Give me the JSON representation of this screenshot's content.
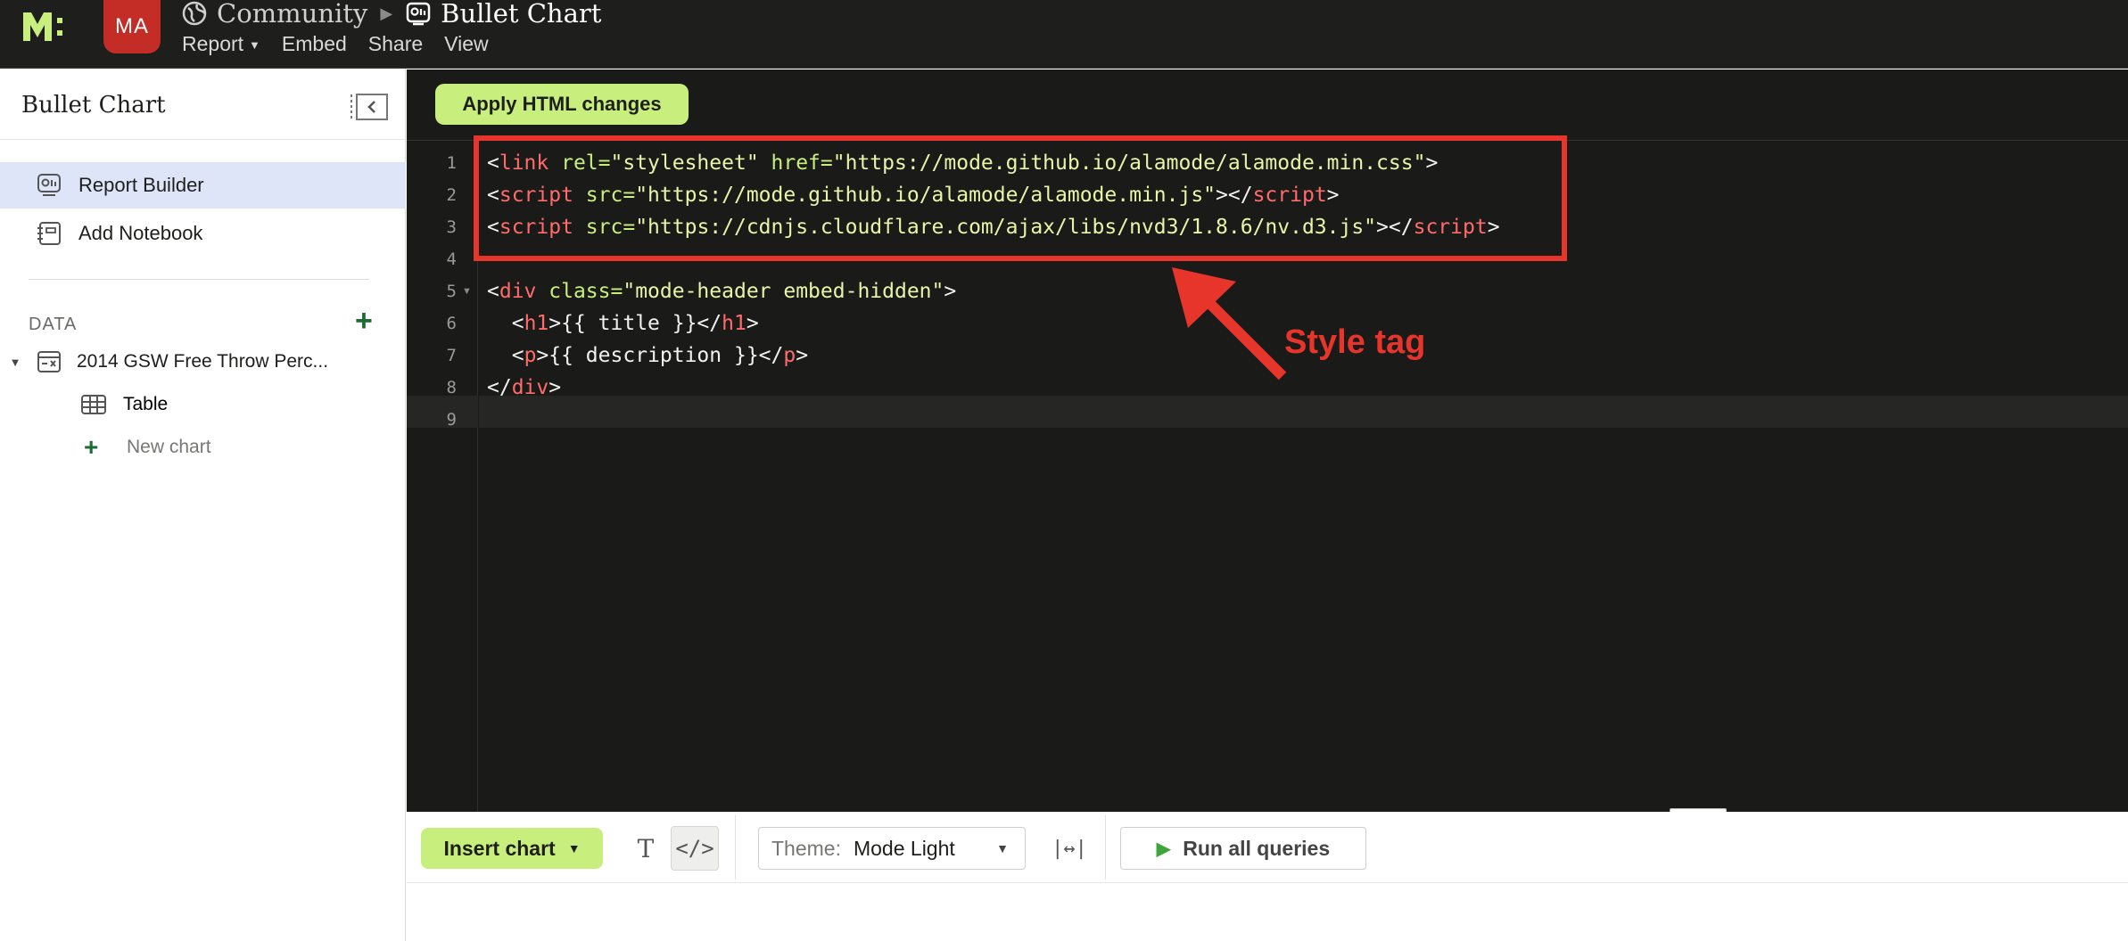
{
  "topbar": {
    "avatar_initials": "MA",
    "breadcrumb": {
      "workspace": "Community",
      "report": "Bullet Chart"
    },
    "menu": {
      "report": "Report",
      "embed": "Embed",
      "share": "Share",
      "view": "View"
    }
  },
  "sidebar": {
    "title": "Bullet Chart",
    "items": [
      {
        "label": "Report Builder",
        "icon": "report-builder-icon",
        "active": true
      },
      {
        "label": "Add Notebook",
        "icon": "notebook-icon",
        "active": false
      }
    ],
    "data_section": {
      "heading": "DATA",
      "dataset": "2014 GSW Free Throw Perc...",
      "children": [
        {
          "label": "Table",
          "icon": "table-icon"
        },
        {
          "label": "New chart",
          "icon": "plus-icon"
        }
      ]
    }
  },
  "editor": {
    "apply_label": "Apply HTML changes",
    "line_numbers": [
      "1",
      "2",
      "3",
      "4",
      "5",
      "6",
      "7",
      "8",
      "9"
    ],
    "code": {
      "l1": {
        "open": "<",
        "tag": "link",
        "attr1": " rel=",
        "val1": "\"stylesheet\"",
        "attr2": " href=",
        "val2": "\"https://mode.github.io/alamode/alamode.min.css\"",
        "close": ">"
      },
      "l2": {
        "open": "<",
        "tag": "script",
        "attr1": " src=",
        "val1": "\"https://mode.github.io/alamode/alamode.min.js\"",
        "mid": "></",
        "tag2": "script",
        "close": ">"
      },
      "l3": {
        "open": "<",
        "tag": "script",
        "attr1": " src=",
        "val1": "\"https://cdnjs.cloudflare.com/ajax/libs/nvd3/1.8.6/nv.d3.js\"",
        "mid": "></",
        "tag2": "script",
        "close": ">"
      },
      "l5": {
        "open": "<",
        "tag": "div",
        "attr1": " class=",
        "val1": "\"mode-header embed-hidden\"",
        "close": ">"
      },
      "l6": {
        "indent": "  ",
        "open": "<",
        "tag": "h1",
        "text": ">{{ title }}</",
        "tag2": "h1",
        "close": ">"
      },
      "l7": {
        "indent": "  ",
        "open": "<",
        "tag": "p",
        "text": ">{{ description }}</",
        "tag2": "p",
        "close": ">"
      },
      "l8": {
        "open": "</",
        "tag": "div",
        "close": ">"
      }
    }
  },
  "annotation": {
    "label": "Style tag",
    "color": "#e8352b"
  },
  "bottombar": {
    "insert_chart": "Insert chart",
    "text_tool": "T",
    "code_tool": "</>",
    "theme_label": "Theme:",
    "theme_value": "Mode Light",
    "width_tool": "|↔|",
    "run_all": "Run all queries"
  },
  "colors": {
    "accent_green": "#c8ef7e",
    "topbar_bg": "#1e1e1c",
    "editor_bg": "#1a1a18",
    "avatar_red": "#c42d26",
    "active_item_bg": "#dfe5f8"
  }
}
